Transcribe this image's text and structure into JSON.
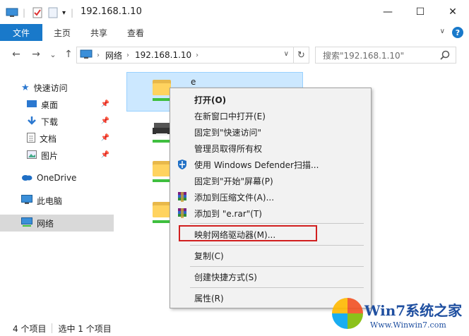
{
  "window": {
    "title": "192.168.1.10",
    "controls": {
      "minimize": "—",
      "maximize": "☐",
      "close": "✕"
    }
  },
  "ribbon": {
    "tabs": [
      "文件",
      "主页",
      "共享",
      "查看"
    ],
    "help": "?"
  },
  "nav": {
    "back": "←",
    "forward": "→",
    "recent": "⌄",
    "up": "↑",
    "breadcrumb": [
      "网络",
      "192.168.1.10"
    ],
    "refresh": "↻",
    "search_placeholder": "搜索\"192.168.1.10\""
  },
  "sidebar": {
    "items": [
      {
        "label": "快速访问",
        "icon": "star-icon"
      },
      {
        "label": "桌面",
        "icon": "desktop-icon",
        "pinned": true
      },
      {
        "label": "下载",
        "icon": "download-icon",
        "pinned": true
      },
      {
        "label": "文档",
        "icon": "document-icon",
        "pinned": true
      },
      {
        "label": "图片",
        "icon": "picture-icon",
        "pinned": true
      },
      {
        "label": "OneDrive",
        "icon": "cloud-icon"
      },
      {
        "label": "此电脑",
        "icon": "computer-icon"
      },
      {
        "label": "网络",
        "icon": "network-icon",
        "selected": true
      }
    ]
  },
  "content": {
    "selected_item_label": "e"
  },
  "context_menu": {
    "items": [
      {
        "label": "打开(O)",
        "bold": true
      },
      {
        "label": "在新窗口中打开(E)"
      },
      {
        "label": "固定到\"快速访问\""
      },
      {
        "label": "管理员取得所有权"
      },
      {
        "label": "使用 Windows Defender扫描...",
        "icon": "shield-icon"
      },
      {
        "label": "固定到\"开始\"屏幕(P)"
      },
      {
        "label": "添加到压缩文件(A)...",
        "icon": "winrar-icon"
      },
      {
        "label": "添加到 \"e.rar\"(T)",
        "icon": "winrar-icon"
      },
      {
        "label": "映射网络驱动器(M)...",
        "highlighted": true
      },
      {
        "label": "复制(C)"
      },
      {
        "label": "创建快捷方式(S)"
      },
      {
        "label": "属性(R)"
      }
    ]
  },
  "status": {
    "item_count": "4 个项目",
    "selected_count": "选中 1 个项目"
  },
  "watermark": {
    "title": "Win7系统之家",
    "url": "Www.Winwin7.com"
  },
  "colors": {
    "accent": "#1979ca",
    "selection": "#cce8ff",
    "highlight_border": "#d11f1f"
  }
}
